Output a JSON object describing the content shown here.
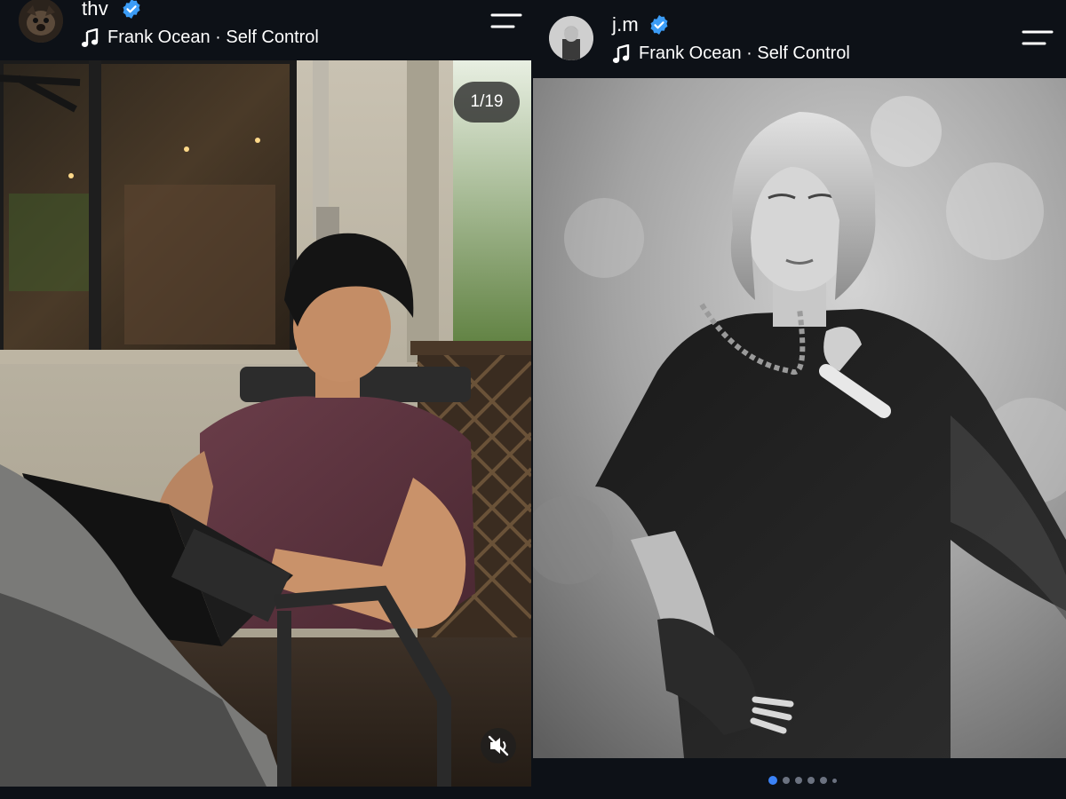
{
  "posts": [
    {
      "username": "thv",
      "verified": true,
      "music": "Frank Ocean · Self Control",
      "counter": "1/19",
      "avatar_icon": "dog-avatar-icon",
      "photo": "man-with-laptop-on-patio-photo",
      "muted": true
    },
    {
      "username": "j.m",
      "verified": true,
      "music": "Frank Ocean · Self Control",
      "avatar_icon": "portrait-avatar-icon",
      "photo": "black-and-white-performer-photo",
      "carousel": {
        "total_dots": 6,
        "active_index": 0
      }
    }
  ],
  "colors": {
    "background": "#0d1117",
    "verified_badge": "#3b9cf6",
    "active_dot": "#3b82f6",
    "inactive_dot": "#6b7280"
  }
}
